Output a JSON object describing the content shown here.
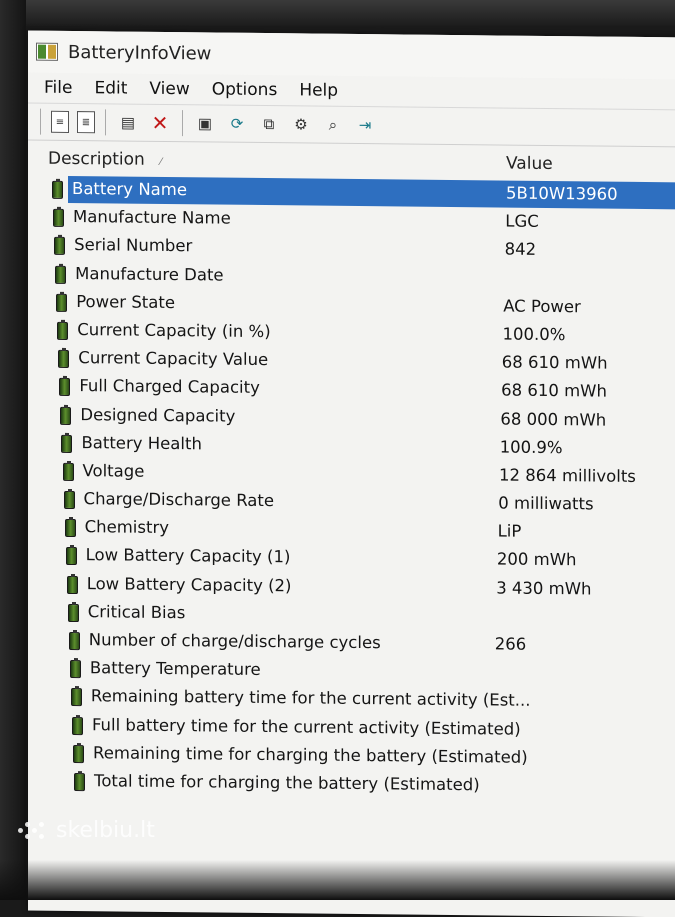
{
  "window": {
    "title": "BatteryInfoView"
  },
  "menu": [
    "File",
    "Edit",
    "View",
    "Options",
    "Help"
  ],
  "toolbar": {
    "icons": [
      "properties-icon",
      "html-report-icon",
      "text-report-icon",
      "delete-icon",
      "save-icon",
      "refresh-icon",
      "copy-icon",
      "options-icon",
      "find-icon",
      "exit-icon"
    ]
  },
  "columns": {
    "description": "Description",
    "value": "Value"
  },
  "rows": [
    {
      "label": "Battery Name",
      "value": "5B10W13960",
      "selected": true
    },
    {
      "label": "Manufacture Name",
      "value": "LGC"
    },
    {
      "label": "Serial Number",
      "value": "842"
    },
    {
      "label": "Manufacture Date",
      "value": ""
    },
    {
      "label": "Power State",
      "value": "AC Power"
    },
    {
      "label": "Current Capacity (in %)",
      "value": "100.0%"
    },
    {
      "label": "Current Capacity Value",
      "value": "68 610 mWh"
    },
    {
      "label": "Full Charged Capacity",
      "value": "68 610 mWh"
    },
    {
      "label": "Designed Capacity",
      "value": "68 000 mWh"
    },
    {
      "label": "Battery Health",
      "value": "100.9%"
    },
    {
      "label": "Voltage",
      "value": "12 864 millivolts"
    },
    {
      "label": "Charge/Discharge Rate",
      "value": "0 milliwatts"
    },
    {
      "label": "Chemistry",
      "value": "LiP"
    },
    {
      "label": "Low Battery Capacity (1)",
      "value": "200 mWh"
    },
    {
      "label": "Low Battery Capacity (2)",
      "value": "3 430 mWh"
    },
    {
      "label": "Critical Bias",
      "value": ""
    },
    {
      "label": "Number of charge/discharge cycles",
      "value": "266"
    },
    {
      "label": "Battery Temperature",
      "value": ""
    },
    {
      "label": "Remaining battery time for the current activity (Est...",
      "value": ""
    },
    {
      "label": "Full battery time for the current activity (Estimated)",
      "value": ""
    },
    {
      "label": "Remaining time for charging the battery (Estimated)",
      "value": ""
    },
    {
      "label": "Total  time for charging the battery (Estimated)",
      "value": ""
    }
  ],
  "watermark": "skelbiu.lt",
  "colors": {
    "selection": "#2e6fc0",
    "battery_icon": "#5c8f2c"
  }
}
